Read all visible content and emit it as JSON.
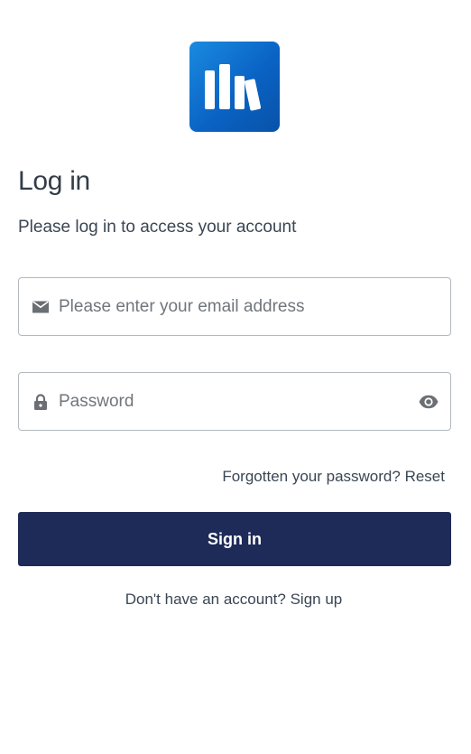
{
  "logo": {
    "icon": "books-logo-icon",
    "color": "#0a63c4"
  },
  "header": {
    "title": "Log in",
    "subtitle": "Please log in to access your account"
  },
  "form": {
    "email": {
      "placeholder": "Please enter your email address",
      "value": "",
      "icon": "envelope-icon"
    },
    "password": {
      "placeholder": "Password",
      "value": "",
      "icon": "lock-icon",
      "toggle_icon": "eye-icon"
    },
    "forgot_text": "Forgotten your password?",
    "reset_label": "Reset",
    "submit_label": "Sign in",
    "submit_color": "#1e2a57"
  },
  "footer": {
    "signup_text": "Don't have an account?",
    "signup_link": "Sign up"
  }
}
